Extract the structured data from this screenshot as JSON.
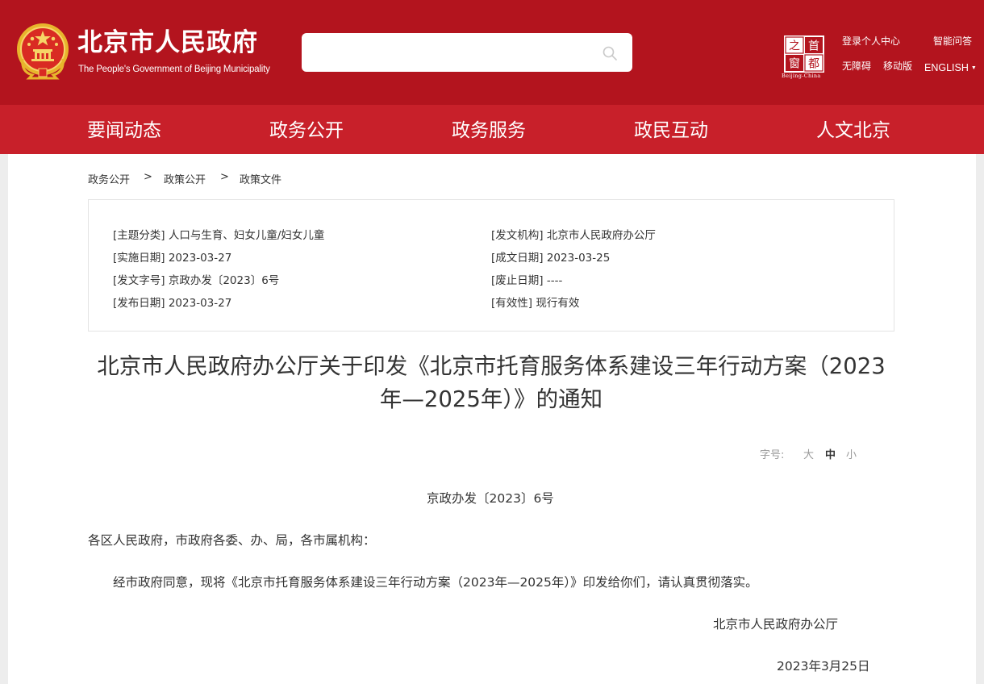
{
  "header": {
    "site_title": "北京市人民政府",
    "site_subtitle": "The People's Government of Beijing Municipality",
    "search": {
      "placeholder": "",
      "value": ""
    },
    "capital_logo": {
      "chars": [
        "之",
        "首",
        "窗",
        "都"
      ],
      "caption": "Beijing-China"
    },
    "links": {
      "login": "登录个人中心",
      "ai_qa": "智能问答",
      "accessibility": "无障碍",
      "mobile": "移动版",
      "english": "ENGLISH"
    },
    "icons": [
      "national-emblem",
      "search-icon",
      "capital-window-logo",
      "caret-down-icon"
    ]
  },
  "nav": {
    "items": [
      {
        "label": "要闻动态"
      },
      {
        "label": "政务公开"
      },
      {
        "label": "政务服务"
      },
      {
        "label": "政民互动"
      },
      {
        "label": "人文北京"
      }
    ]
  },
  "breadcrumb": {
    "items": [
      "政务公开",
      "政策公开",
      "政策文件"
    ],
    "separator": ">"
  },
  "meta": {
    "topic_label": "[主题分类]",
    "topic_value": "人口与生育、妇女儿童/妇女儿童",
    "issuer_label": "[发文机构]",
    "issuer_value": "北京市人民政府办公厅",
    "effective_label": "[实施日期]",
    "effective_value": "2023-03-27",
    "written_label": "[成文日期]",
    "written_value": "2023-03-25",
    "docno_label": "[发文字号]",
    "docno_value": "京政办发〔2023〕6号",
    "abolish_label": "[废止日期]",
    "abolish_value": "----",
    "published_label": "[发布日期]",
    "published_value": "2023-03-27",
    "validity_label": "[有效性]",
    "validity_value": "现行有效"
  },
  "document": {
    "title_line1": "北京市人民政府办公厅关于印发《北京市托育服务体系建设三年行动方案（2023",
    "title_line2": "年—2025年）》的通知",
    "font_size": {
      "label": "字号:",
      "large": "大",
      "medium": "中",
      "small": "小",
      "selected": "中"
    },
    "doc_number": "京政办发〔2023〕6号",
    "addressee": "各区人民政府，市政府各委、办、局，各市属机构：",
    "body": "经市政府同意，现将《北京市托育服务体系建设三年行动方案（2023年—2025年）》印发给你们，请认真贯彻落实。",
    "signature": "北京市人民政府办公厅",
    "date": "2023年3月25日"
  },
  "colors": {
    "header_bg": "#b3141e",
    "nav_bg": "#c8202a",
    "page_bg": "#ededed",
    "content_bg": "#ffffff",
    "text": "#333333",
    "muted": "#999999",
    "emblem_gold": "#f5c242"
  }
}
